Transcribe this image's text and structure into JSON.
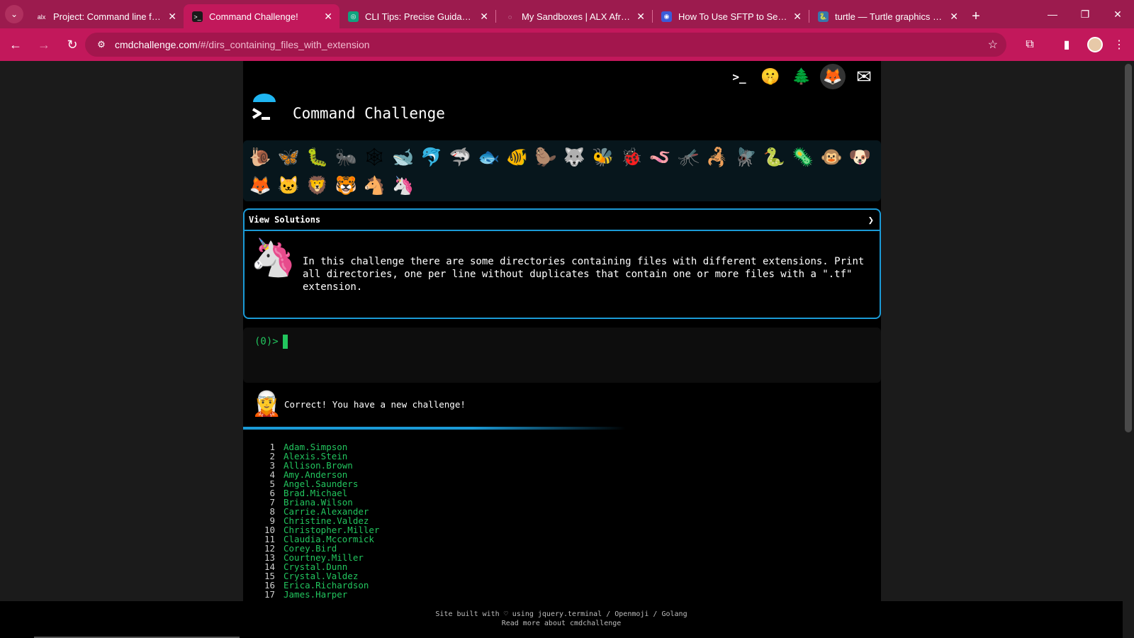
{
  "browser": {
    "tabs": [
      {
        "title": "Project: Command line for th",
        "favicon": "alx",
        "favicon_color": "#9c1b4e",
        "icon_name": "alx-favicon"
      },
      {
        "title": "Command Challenge!",
        "favicon": ">_",
        "favicon_color": "#1a1a1a",
        "icon_name": "terminal-favicon",
        "active": true
      },
      {
        "title": "CLI Tips: Precise Guidance",
        "favicon": "◎",
        "favicon_color": "#10a37f",
        "icon_name": "chatgpt-favicon"
      },
      {
        "title": "My Sandboxes | ALX Africa In",
        "favicon": "◌",
        "favicon_color": "#9c1b4e",
        "icon_name": "loading-favicon"
      },
      {
        "title": "How To Use SFTP to Securely",
        "favicon": "◉",
        "favicon_color": "#3a5bd9",
        "icon_name": "digitalocean-favicon"
      },
      {
        "title": "turtle — Turtle graphics for T",
        "favicon": "🐍",
        "favicon_color": "#3776ab",
        "icon_name": "python-favicon"
      }
    ],
    "new_tab": "+",
    "url_domain": "cmdchallenge.com",
    "url_path": "/#/dirs_containing_files_with_extension"
  },
  "page": {
    "title": "Command Challenge",
    "top_icons": [
      {
        "name": "terminal-icon",
        "glyph": ">_",
        "bg": "#000000"
      },
      {
        "name": "shushing-face-icon",
        "glyph": "🤫",
        "bg": "#000000"
      },
      {
        "name": "tree-icon",
        "glyph": "🌲",
        "bg": "#000000"
      },
      {
        "name": "gitlab-icon",
        "glyph": "🦊",
        "bg": "#333333"
      },
      {
        "name": "mail-icon",
        "glyph": "✉",
        "bg": "#000000"
      }
    ],
    "challenges": [
      {
        "name": "snail-icon",
        "glyph": "🐌"
      },
      {
        "name": "butterfly-icon",
        "glyph": "🦋"
      },
      {
        "name": "caterpillar-icon",
        "glyph": "🐛"
      },
      {
        "name": "ant-icon",
        "glyph": "🐜"
      },
      {
        "name": "spider-web-icon",
        "glyph": "🕸"
      },
      {
        "name": "whale-icon",
        "glyph": "🐋"
      },
      {
        "name": "dolphin-icon",
        "glyph": "🐬"
      },
      {
        "name": "shark-icon",
        "glyph": "🦈"
      },
      {
        "name": "fish-icon",
        "glyph": "🐟"
      },
      {
        "name": "tropical-fish-icon",
        "glyph": "🐠"
      },
      {
        "name": "beaver-icon",
        "glyph": "🦫"
      },
      {
        "name": "wolf-icon",
        "glyph": "🐺"
      },
      {
        "name": "bee-icon",
        "glyph": "🐝"
      },
      {
        "name": "ladybug-icon",
        "glyph": "🐞"
      },
      {
        "name": "worm-icon",
        "glyph": "🪱"
      },
      {
        "name": "mosquito-icon",
        "glyph": "🦟"
      },
      {
        "name": "scorpion-icon",
        "glyph": "🦂"
      },
      {
        "name": "fly-icon",
        "glyph": "🪰"
      },
      {
        "name": "snake-icon",
        "glyph": "🐍"
      },
      {
        "name": "microbe-icon",
        "glyph": "🦠"
      },
      {
        "name": "monkey-icon",
        "glyph": "🐵"
      },
      {
        "name": "dog-icon",
        "glyph": "🐶"
      },
      {
        "name": "fox-icon",
        "glyph": "🦊"
      },
      {
        "name": "cat-icon",
        "glyph": "🐱"
      },
      {
        "name": "lion-icon",
        "glyph": "🦁"
      },
      {
        "name": "tiger-icon",
        "glyph": "🐯"
      },
      {
        "name": "horse-icon",
        "glyph": "🐴"
      },
      {
        "name": "unicorn-icon",
        "glyph": "🦄"
      }
    ],
    "solutions_header": "View Solutions",
    "challenge_text": "In this challenge there are some directories containing files with different extensions. Print all directories, one per line without duplicates that contain one or more files with a \".tf\" extension.",
    "prompt": "(0)>",
    "status_message": "Correct! You have a new challenge!",
    "progress": 0.6,
    "output_lines": [
      "Adam.Simpson",
      "Alexis.Stein",
      "Allison.Brown",
      "Amy.Anderson",
      "Angel.Saunders",
      "Brad.Michael",
      "Briana.Wilson",
      "Carrie.Alexander",
      "Christine.Valdez",
      "Christopher.Miller",
      "Claudia.Mccormick",
      "Corey.Bird",
      "Courtney.Miller",
      "Crystal.Dunn",
      "Crystal.Valdez",
      "Erica.Richardson",
      "James.Harper"
    ],
    "footer_line1": "Site built with ♡ using jquery.terminal / Openmoji / Golang",
    "footer_line2": "Read more about cmdchallenge"
  },
  "colors": {
    "chrome": "#c2185b",
    "accent": "#1b9ad6",
    "terminal_green": "#22c55e"
  }
}
